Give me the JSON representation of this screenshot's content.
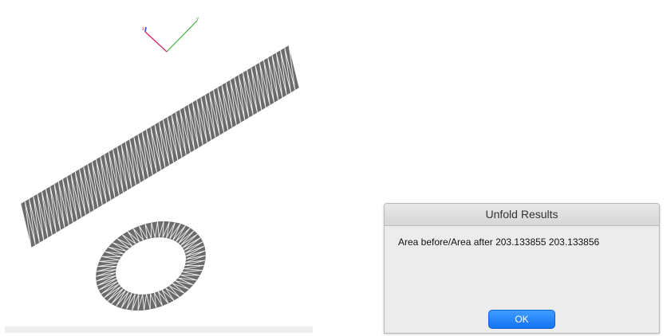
{
  "viewport": {
    "axis_labels": {
      "x": "x",
      "y": "y"
    },
    "colors": {
      "mesh_fill": "#6b6b6b",
      "mesh_line": "#f2f2f2",
      "axis_x": "#d6205a",
      "axis_y": "#3fae3f",
      "axis_z": "#2d4fd6"
    }
  },
  "dialog": {
    "title": "Unfold Results",
    "message": "Area before/Area after 203.133855 203.133856",
    "ok_label": "OK"
  }
}
